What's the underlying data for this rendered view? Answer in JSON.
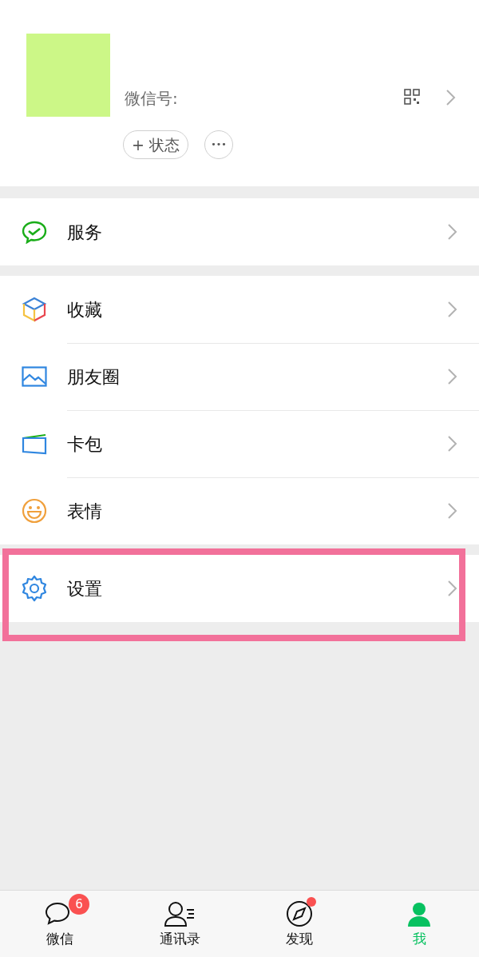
{
  "profile": {
    "wechat_id_label": "微信号:",
    "status_button": "+ 状态",
    "more_button": "•••"
  },
  "groups": [
    [
      {
        "label": "服务",
        "kind": "service",
        "highlighted": false
      }
    ],
    [
      {
        "label": "收藏",
        "kind": "favorites",
        "highlighted": false
      },
      {
        "label": "朋友圈",
        "kind": "moments",
        "highlighted": false
      },
      {
        "label": "卡包",
        "kind": "cards",
        "highlighted": false
      },
      {
        "label": "表情",
        "kind": "stickers",
        "highlighted": false
      }
    ],
    [
      {
        "label": "设置",
        "kind": "settings",
        "highlighted": true
      }
    ]
  ],
  "tabs": [
    {
      "label": "微信",
      "kind": "chats",
      "badge": "6",
      "dot": false,
      "selected": false
    },
    {
      "label": "通讯录",
      "kind": "contacts",
      "dot": false,
      "selected": false
    },
    {
      "label": "发现",
      "kind": "discover",
      "dot": true,
      "selected": false
    },
    {
      "label": "我",
      "kind": "me",
      "dot": false,
      "selected": true
    }
  ]
}
